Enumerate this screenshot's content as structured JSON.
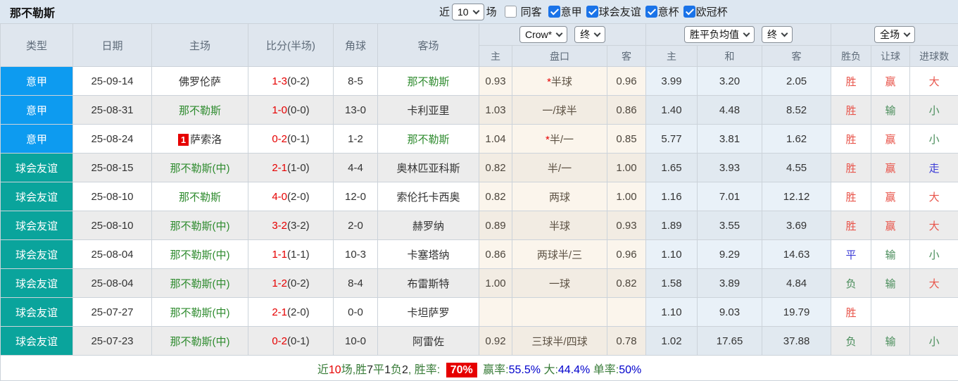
{
  "title": "那不勒斯",
  "filters": {
    "near_label": "近",
    "near_value": "10",
    "games_label": "场",
    "same_venue": {
      "label": "同客",
      "checked": false
    },
    "competitions": [
      {
        "label": "意甲",
        "checked": true
      },
      {
        "label": "球会友谊",
        "checked": true
      },
      {
        "label": "意杯",
        "checked": true
      },
      {
        "label": "欧冠杯",
        "checked": true
      }
    ]
  },
  "table": {
    "columns": {
      "type": "类型",
      "date": "日期",
      "home": "主场",
      "score": "比分(半场)",
      "corner": "角球",
      "away": "客场"
    },
    "dropdowns": {
      "company": "Crow*",
      "company_state": "终",
      "avg": "胜平负均值",
      "avg_state": "终",
      "scope": "全场"
    },
    "sub_columns": {
      "crow": [
        "主",
        "盘口",
        "客"
      ],
      "avg": [
        "主",
        "和",
        "客"
      ],
      "result": [
        "胜负",
        "让球",
        "进球数"
      ]
    }
  },
  "rows": [
    {
      "league": "意甲",
      "date": "25-09-14",
      "home": "佛罗伦萨",
      "home_badge": "",
      "score": "1-3",
      "half": "0-2",
      "corner": "8-5",
      "away": "那不勒斯",
      "odds": [
        "0.93",
        "*半球",
        "0.96"
      ],
      "avg": [
        "3.99",
        "3.20",
        "2.05"
      ],
      "result": [
        "胜",
        "赢",
        "大"
      ]
    },
    {
      "league": "意甲",
      "date": "25-08-31",
      "home": "那不勒斯",
      "home_badge": "",
      "score": "1-0",
      "half": "0-0",
      "corner": "13-0",
      "away": "卡利亚里",
      "odds": [
        "1.03",
        "一/球半",
        "0.86"
      ],
      "avg": [
        "1.40",
        "4.48",
        "8.52"
      ],
      "result": [
        "胜",
        "输",
        "小"
      ]
    },
    {
      "league": "意甲",
      "date": "25-08-24",
      "home": "萨索洛",
      "home_badge": "1",
      "score": "0-2",
      "half": "0-1",
      "corner": "1-2",
      "away": "那不勒斯",
      "odds": [
        "1.04",
        "*半/一",
        "0.85"
      ],
      "avg": [
        "5.77",
        "3.81",
        "1.62"
      ],
      "result": [
        "胜",
        "赢",
        "小"
      ]
    },
    {
      "league": "球会友谊",
      "date": "25-08-15",
      "home": "那不勒斯(中)",
      "home_badge": "",
      "score": "2-1",
      "half": "1-0",
      "corner": "4-4",
      "away": "奥林匹亚科斯",
      "odds": [
        "0.82",
        "半/一",
        "1.00"
      ],
      "avg": [
        "1.65",
        "3.93",
        "4.55"
      ],
      "result": [
        "胜",
        "赢",
        "走"
      ]
    },
    {
      "league": "球会友谊",
      "date": "25-08-10",
      "home": "那不勒斯",
      "home_badge": "",
      "score": "4-0",
      "half": "2-0",
      "corner": "12-0",
      "away": "索伦托卡西奥",
      "odds": [
        "0.82",
        "两球",
        "1.00"
      ],
      "avg": [
        "1.16",
        "7.01",
        "12.12"
      ],
      "result": [
        "胜",
        "赢",
        "大"
      ]
    },
    {
      "league": "球会友谊",
      "date": "25-08-10",
      "home": "那不勒斯(中)",
      "home_badge": "",
      "score": "3-2",
      "half": "3-2",
      "corner": "2-0",
      "away": "赫罗纳",
      "odds": [
        "0.89",
        "半球",
        "0.93"
      ],
      "avg": [
        "1.89",
        "3.55",
        "3.69"
      ],
      "result": [
        "胜",
        "赢",
        "大"
      ]
    },
    {
      "league": "球会友谊",
      "date": "25-08-04",
      "home": "那不勒斯(中)",
      "home_badge": "",
      "score": "1-1",
      "half": "1-1",
      "corner": "10-3",
      "away": "卡塞塔纳",
      "odds": [
        "0.86",
        "两球半/三",
        "0.96"
      ],
      "avg": [
        "1.10",
        "9.29",
        "14.63"
      ],
      "result": [
        "平",
        "输",
        "小"
      ]
    },
    {
      "league": "球会友谊",
      "date": "25-08-04",
      "home": "那不勒斯(中)",
      "home_badge": "",
      "score": "1-2",
      "half": "0-2",
      "corner": "8-4",
      "away": "布雷斯特",
      "odds": [
        "1.00",
        "一球",
        "0.82"
      ],
      "avg": [
        "1.58",
        "3.89",
        "4.84"
      ],
      "result": [
        "负",
        "输",
        "大"
      ]
    },
    {
      "league": "球会友谊",
      "date": "25-07-27",
      "home": "那不勒斯(中)",
      "home_badge": "",
      "score": "2-1",
      "half": "2-0",
      "corner": "0-0",
      "away": "卡坦萨罗",
      "odds": [
        "",
        "",
        ""
      ],
      "avg": [
        "1.10",
        "9.03",
        "19.79"
      ],
      "result": [
        "胜",
        "",
        ""
      ]
    },
    {
      "league": "球会友谊",
      "date": "25-07-23",
      "home": "那不勒斯(中)",
      "home_badge": "",
      "score": "0-2",
      "half": "0-1",
      "corner": "10-0",
      "away": "阿雷佐",
      "odds": [
        "0.92",
        "三球半/四球",
        "0.78"
      ],
      "avg": [
        "1.02",
        "17.65",
        "37.88"
      ],
      "result": [
        "负",
        "输",
        "小"
      ]
    }
  ],
  "summary": {
    "pieces": [
      {
        "text": "近",
        "style": "green"
      },
      {
        "text": "10",
        "style": "red"
      },
      {
        "text": "场,胜",
        "style": "green"
      },
      {
        "text": "7",
        "style": "dark"
      },
      {
        "text": "平",
        "style": "green"
      },
      {
        "text": "1",
        "style": "dark"
      },
      {
        "text": "负",
        "style": "green"
      },
      {
        "text": "2",
        "style": "dark"
      },
      {
        "text": ", 胜率: ",
        "style": "green"
      },
      {
        "text": "70%",
        "style": "badge"
      },
      {
        "text": " 赢率:",
        "style": "green"
      },
      {
        "text": "55.5%",
        "style": "blue"
      },
      {
        "text": " 大:",
        "style": "green"
      },
      {
        "text": "44.4%",
        "style": "blue"
      },
      {
        "text": " 单率:",
        "style": "green"
      },
      {
        "text": "50%",
        "style": "blue"
      }
    ]
  }
}
